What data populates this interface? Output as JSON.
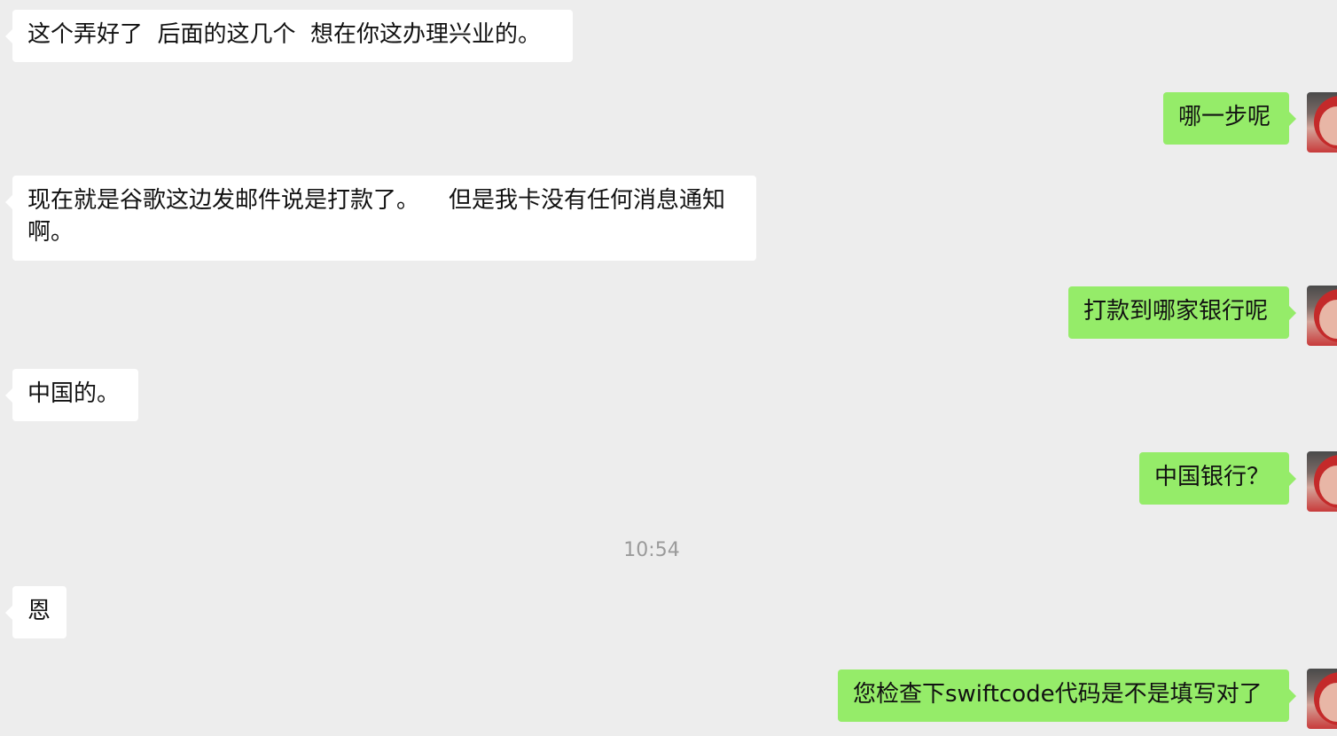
{
  "messages": [
    {
      "side": "left",
      "text": "这个弄好了  后面的这几个  想在你这办理兴业的。"
    },
    {
      "side": "right",
      "text": "哪一步呢"
    },
    {
      "side": "left",
      "text": "现在就是谷歌这边发邮件说是打款了。    但是我卡没有任何消息通知啊。"
    },
    {
      "side": "right",
      "text": "打款到哪家银行呢"
    },
    {
      "side": "left",
      "text": "中国的。"
    },
    {
      "side": "right",
      "text": "中国银行？"
    },
    {
      "side": "left",
      "text": "恩"
    },
    {
      "side": "right",
      "text": "您检查下swiftcode代码是不是填写对了"
    }
  ],
  "timestamp": "10:54",
  "colors": {
    "background": "#ededed",
    "incoming_bubble": "#ffffff",
    "outgoing_bubble": "#95ec69"
  },
  "icons": {
    "avatar": "user-avatar-photo"
  }
}
